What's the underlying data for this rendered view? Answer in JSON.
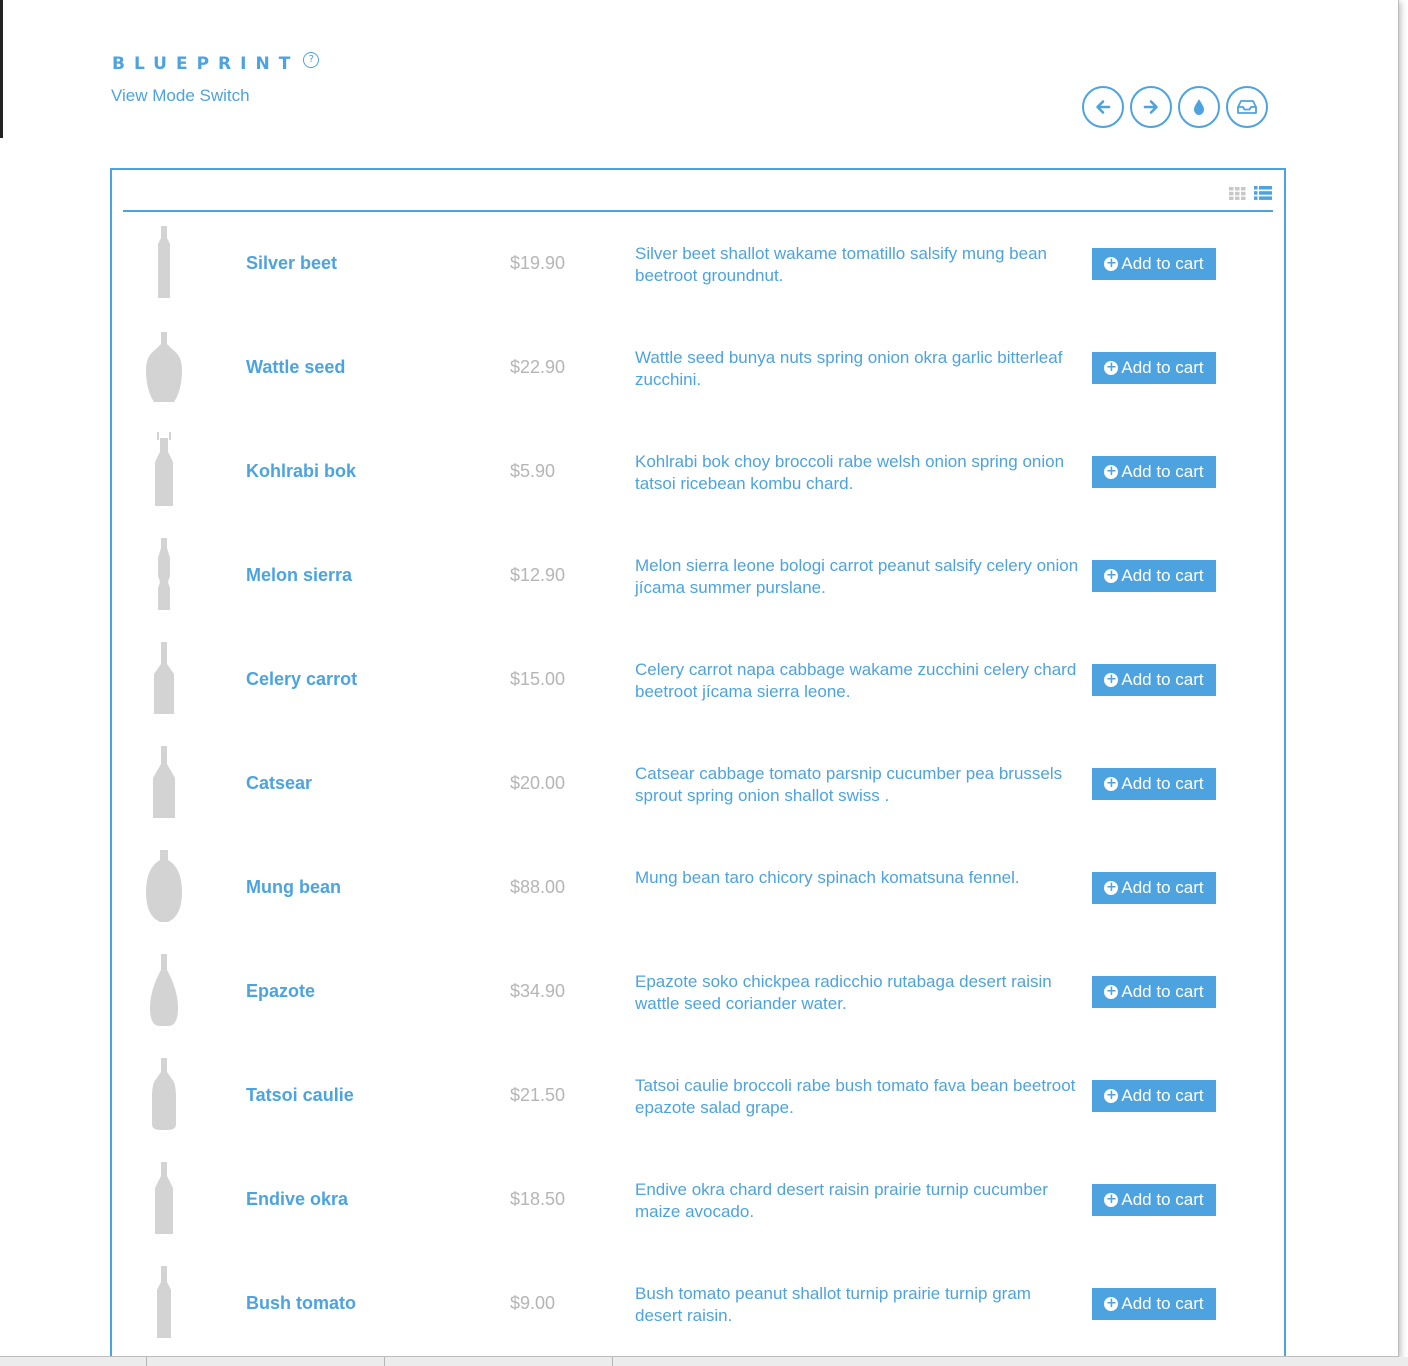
{
  "header": {
    "logo": "BLUEPRINT",
    "help_icon": "?",
    "subtitle": "View Mode Switch"
  },
  "toolbar": {
    "buttons": [
      {
        "name": "arrow-left-icon"
      },
      {
        "name": "arrow-right-icon"
      },
      {
        "name": "droplet-icon"
      },
      {
        "name": "inbox-icon"
      }
    ]
  },
  "view_toggle": {
    "modes": [
      "grid",
      "list"
    ],
    "active": "list"
  },
  "colors": {
    "accent": "#4da3e0",
    "price": "#b5b5b5",
    "thumbnail": "#d3d3d3"
  },
  "products": [
    {
      "name": "Silver beet",
      "price": "$19.90",
      "description": "Silver beet shallot wakame tomatillo salsify mung bean beetroot groundnut.",
      "cart_label": "Add to cart",
      "bottle": "tall"
    },
    {
      "name": "Wattle seed",
      "price": "$22.90",
      "description": "Wattle seed bunya nuts spring onion okra garlic bitterleaf zucchini.",
      "cart_label": "Add to cart",
      "bottle": "flask"
    },
    {
      "name": "Kohlrabi bok",
      "price": "$5.90",
      "description": "Kohlrabi bok choy broccoli rabe welsh onion spring onion tatsoi ricebean kombu chard.",
      "cart_label": "Add to cart",
      "bottle": "swing"
    },
    {
      "name": "Melon sierra",
      "price": "$12.90",
      "description": "Melon sierra leone bologi carrot peanut salsify celery onion jícama summer purslane.",
      "cart_label": "Add to cart",
      "bottle": "soda"
    },
    {
      "name": "Celery carrot",
      "price": "$15.00",
      "description": "Celery carrot napa cabbage wakame zucchini celery chard beetroot jícama sierra leone.",
      "cart_label": "Add to cart",
      "bottle": "square"
    },
    {
      "name": "Catsear",
      "price": "$20.00",
      "description": "Catsear cabbage tomato parsnip cucumber pea brussels sprout spring onion shallot swiss .",
      "cart_label": "Add to cart",
      "bottle": "wine"
    },
    {
      "name": "Mung bean",
      "price": "$88.00",
      "description": "Mung bean taro chicory spinach komatsuna fennel.",
      "cart_label": "Add to cart",
      "bottle": "round"
    },
    {
      "name": "Epazote",
      "price": "$34.90",
      "description": "Epazote soko chickpea radicchio rutabaga desert raisin wattle seed coriander water.",
      "cart_label": "Add to cart",
      "bottle": "drop"
    },
    {
      "name": "Tatsoi caulie",
      "price": "$21.50",
      "description": "Tatsoi caulie broccoli rabe bush tomato fava bean beetroot epazote salad grape.",
      "cart_label": "Add to cart",
      "bottle": "shoulder"
    },
    {
      "name": "Endive okra",
      "price": "$18.50",
      "description": "Endive okra chard desert raisin prairie turnip cucumber maize avocado.",
      "cart_label": "Add to cart",
      "bottle": "classic"
    },
    {
      "name": "Bush tomato",
      "price": "$9.00",
      "description": "Bush tomato peanut shallot turnip prairie turnip gram desert raisin.",
      "cart_label": "Add to cart",
      "bottle": "slim"
    }
  ]
}
